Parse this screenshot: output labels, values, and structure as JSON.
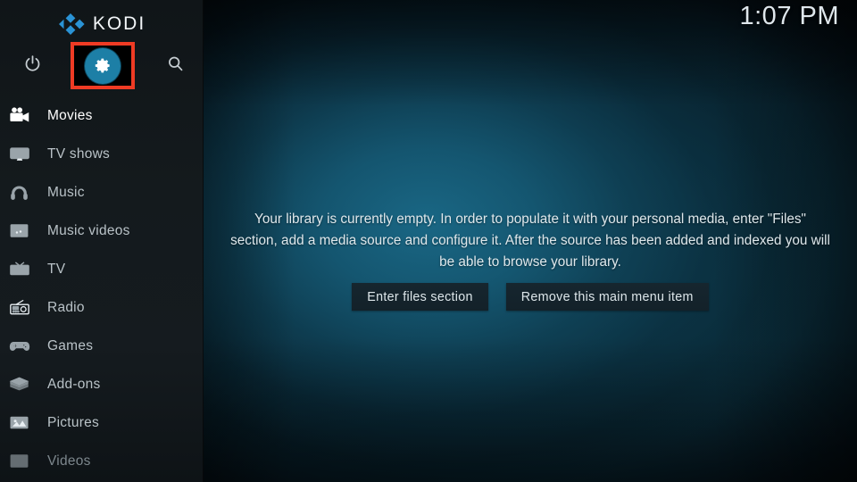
{
  "app": {
    "name": "KODI",
    "logo_icon": "kodi-logo-icon",
    "accent_color": "#1d7fa6",
    "annotation_color": "#ef3b24"
  },
  "header": {
    "clock": "1:07 PM"
  },
  "sidebar": {
    "top_actions": [
      {
        "name": "power",
        "icon": "power-icon",
        "label": "Power"
      },
      {
        "name": "settings",
        "icon": "gear-icon",
        "label": "Settings",
        "highlighted": true
      },
      {
        "name": "search",
        "icon": "search-icon",
        "label": "Search"
      }
    ],
    "items": [
      {
        "label": "Movies",
        "icon": "movie-camera-icon",
        "state": "selected"
      },
      {
        "label": "TV shows",
        "icon": "television-icon",
        "state": "normal"
      },
      {
        "label": "Music",
        "icon": "headphones-icon",
        "state": "normal"
      },
      {
        "label": "Music videos",
        "icon": "music-film-icon",
        "state": "normal"
      },
      {
        "label": "TV",
        "icon": "tv-box-icon",
        "state": "normal"
      },
      {
        "label": "Radio",
        "icon": "radio-icon",
        "state": "normal"
      },
      {
        "label": "Games",
        "icon": "gamepad-icon",
        "state": "normal"
      },
      {
        "label": "Add-ons",
        "icon": "addons-box-icon",
        "state": "normal"
      },
      {
        "label": "Pictures",
        "icon": "picture-icon",
        "state": "normal"
      },
      {
        "label": "Videos",
        "icon": "film-strip-icon",
        "state": "dim"
      }
    ]
  },
  "main": {
    "empty_message": "Your library is currently empty. In order to populate it with your personal media, enter \"Files\" section, add a media source and configure it. After the source has been added and indexed you will be able to browse your library.",
    "buttons": [
      {
        "label": "Enter files section"
      },
      {
        "label": "Remove this main menu item"
      }
    ]
  }
}
